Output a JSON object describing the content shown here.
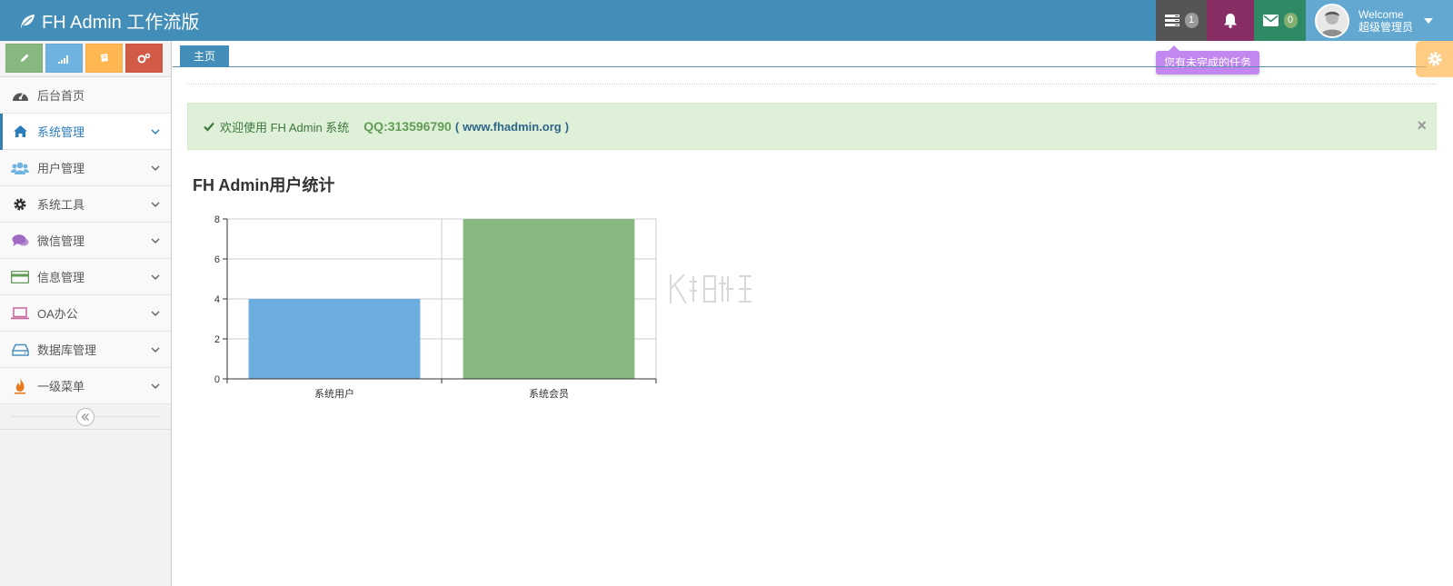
{
  "navbar": {
    "brand": "FH Admin 工作流版",
    "tasks_badge": "1",
    "mail_badge": "0",
    "welcome": "Welcome",
    "username": "超级管理员",
    "tasks_tooltip": "您有未完成的任务"
  },
  "sidebar": {
    "shortcuts": [
      "pencil-icon",
      "signal-icon",
      "book-icon",
      "cogs-icon"
    ],
    "items": [
      {
        "label": "后台首页",
        "icon": "dashboard-icon"
      },
      {
        "label": "系统管理",
        "icon": "home-icon"
      },
      {
        "label": "用户管理",
        "icon": "users-icon"
      },
      {
        "label": "系统工具",
        "icon": "cog-icon"
      },
      {
        "label": "微信管理",
        "icon": "comments-icon"
      },
      {
        "label": "信息管理",
        "icon": "credit-card-icon"
      },
      {
        "label": "OA办公",
        "icon": "laptop-icon"
      },
      {
        "label": "数据库管理",
        "icon": "hdd-icon"
      },
      {
        "label": "一级菜单",
        "icon": "fire-icon"
      }
    ]
  },
  "tabs": {
    "home": "主页"
  },
  "alert": {
    "message": "欢迎使用 FH Admin 系统",
    "qq": "QQ:313596790",
    "site_open": "(",
    "site": "www.fhadmin.org",
    "site_close": ")",
    "close": "×"
  },
  "colors": {
    "navbar": "#438eb9",
    "bar_1": "#6caedf",
    "bar_2": "#87b87f"
  },
  "chart_data": {
    "type": "bar",
    "title": "FH Admin用户统计",
    "categories": [
      "系统用户",
      "系统会员"
    ],
    "values": [
      4,
      8
    ],
    "ylim": [
      0,
      8
    ],
    "yticks": [
      0,
      2,
      4,
      6,
      8
    ],
    "grid": true,
    "legend": "none"
  }
}
